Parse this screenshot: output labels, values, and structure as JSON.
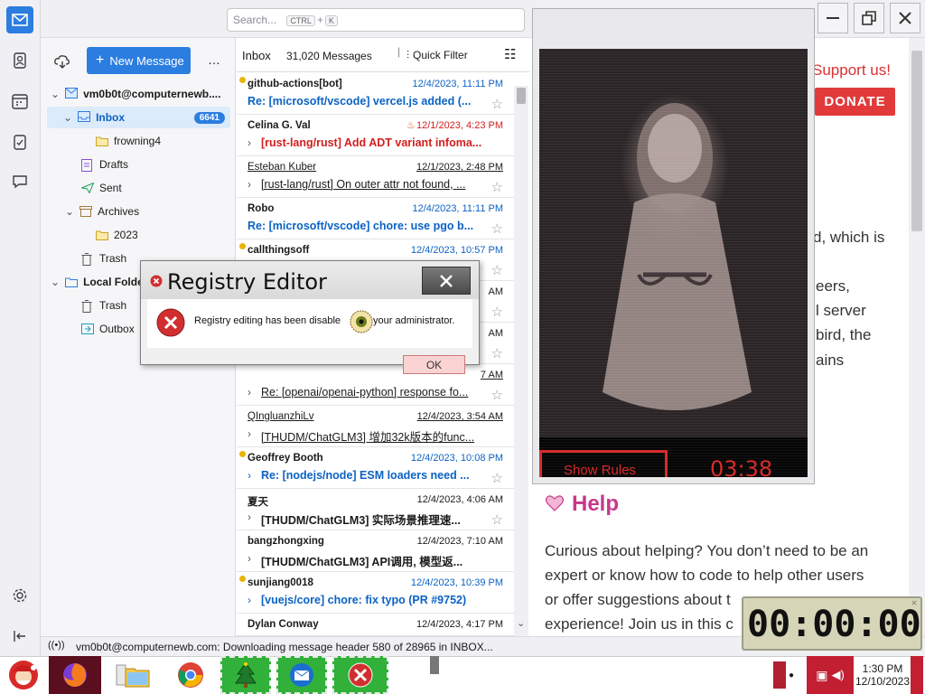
{
  "search": {
    "placeholder": "Search...",
    "key1": "CTRL",
    "plus": "+",
    "key2": "K"
  },
  "folder_pane": {
    "new_message": "New Message",
    "more": "…",
    "account": "vm0b0t@computernewb....",
    "items": [
      {
        "label": "Inbox",
        "badge": "6641"
      },
      {
        "label": "frowning4"
      },
      {
        "label": "Drafts"
      },
      {
        "label": "Sent"
      },
      {
        "label": "Archives"
      },
      {
        "label": "2023"
      },
      {
        "label": "Trash"
      },
      {
        "label": "Local Folders"
      },
      {
        "label": "Trash"
      },
      {
        "label": "Outbox"
      }
    ]
  },
  "message_list": {
    "folder": "Inbox",
    "count": "31,020 Messages",
    "quick_filter": "Quick Filter",
    "messages": [
      {
        "from": "github-actions[bot]",
        "date": "12/4/2023, 11:11 PM",
        "subject": "Re: [microsoft/vscode] vercel.js added (..."
      },
      {
        "from": "Celina G. Val",
        "date": "12/1/2023, 4:23 PM",
        "subject": "[rust-lang/rust] Add ADT variant infoma..."
      },
      {
        "from": "Esteban Kuber",
        "date": "12/1/2023, 2:48 PM",
        "subject": "[rust-lang/rust] On outer attr not found, ..."
      },
      {
        "from": "Robo",
        "date": "12/4/2023, 11:11 PM",
        "subject": "Re: [microsoft/vscode] chore: use pgo b..."
      },
      {
        "from": "callthingsoff",
        "date": "12/4/2023, 10:57 PM",
        "subject": ""
      },
      {
        "from": "",
        "date": "AM",
        "subject": ""
      },
      {
        "from": "",
        "date": "AM",
        "subject": ""
      },
      {
        "from": "",
        "date": "7 AM",
        "subject": "Re: [openai/openai-python] response fo..."
      },
      {
        "from": "QIngluanzhiLv",
        "date": "12/4/2023, 3:54 AM",
        "subject": "[THUDM/ChatGLM3] 增加32k版本的func..."
      },
      {
        "from": "Geoffrey Booth",
        "date": "12/4/2023, 10:08 PM",
        "subject": "Re: [nodejs/node] ESM loaders need ..."
      },
      {
        "from": "夏天",
        "date": "12/4/2023, 4:06 AM",
        "subject": "[THUDM/ChatGLM3] 实际场景推理速..."
      },
      {
        "from": "bangzhongxing",
        "date": "12/4/2023, 7:10 AM",
        "subject": "[THUDM/ChatGLM3] API调用, 模型返..."
      },
      {
        "from": "sunjiang0018",
        "date": "12/4/2023, 10:39 PM",
        "subject": "[vuejs/core] chore: fix typo (PR #9752)"
      },
      {
        "from": "Dylan Conway",
        "date": "12/4/2023, 4:17 PM",
        "subject": ""
      }
    ]
  },
  "web": {
    "support": "Support us!",
    "donate": "DONATE",
    "frag1": "d, which is",
    "frag2": "eers,",
    "frag3": "l server",
    "frag4": "bird, the",
    "frag5": "ains",
    "help_title": "Help",
    "help_body1": "Curious about helping? You don’t need to be an",
    "help_body2": "expert or know how to code to help other users",
    "help_body3": "or offer suggestions about t",
    "help_body4": "experience! Join us in this c"
  },
  "video": {
    "show_rules": "Show Rules",
    "timer": "03:38"
  },
  "dialog": {
    "title": "Registry Editor",
    "message_a": "Registry editing has been disable",
    "message_b": "your administrator.",
    "ok": "OK"
  },
  "status": {
    "text": "vm0b0t@computernewb.com: Downloading message header 580 of 28965 in INBOX..."
  },
  "timer_widget": {
    "display": "00:00:00"
  },
  "taskbar": {
    "time": "1:30 PM",
    "date": "12/10/2023"
  }
}
